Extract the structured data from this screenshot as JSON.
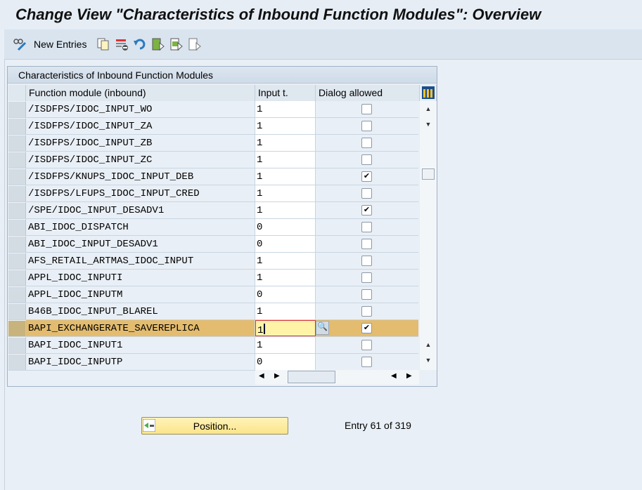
{
  "title": "Change View \"Characteristics of Inbound Function Modules\": Overview",
  "toolbar": {
    "new_entries": "New Entries",
    "icons": [
      "display-change-icon",
      "copy-icon",
      "delete-icon",
      "undo-icon",
      "select-all-icon",
      "select-block-icon",
      "deselect-all-icon"
    ]
  },
  "table": {
    "title": "Characteristics of Inbound Function Modules",
    "columns": [
      "Function module (inbound)",
      "Input t.",
      "Dialog allowed"
    ],
    "rows": [
      {
        "name": "/ISDFPS/IDOC_INPUT_WO",
        "input": "1",
        "dialog": false
      },
      {
        "name": "/ISDFPS/IDOC_INPUT_ZA",
        "input": "1",
        "dialog": false
      },
      {
        "name": "/ISDFPS/IDOC_INPUT_ZB",
        "input": "1",
        "dialog": false
      },
      {
        "name": "/ISDFPS/IDOC_INPUT_ZC",
        "input": "1",
        "dialog": false
      },
      {
        "name": "/ISDFPS/KNUPS_IDOC_INPUT_DEB",
        "input": "1",
        "dialog": true
      },
      {
        "name": "/ISDFPS/LFUPS_IDOC_INPUT_CRED",
        "input": "1",
        "dialog": false
      },
      {
        "name": "/SPE/IDOC_INPUT_DESADV1",
        "input": "1",
        "dialog": true
      },
      {
        "name": "ABI_IDOC_DISPATCH",
        "input": "0",
        "dialog": false
      },
      {
        "name": "ABI_IDOC_INPUT_DESADV1",
        "input": "0",
        "dialog": false
      },
      {
        "name": "AFS_RETAIL_ARTMAS_IDOC_INPUT",
        "input": "1",
        "dialog": false
      },
      {
        "name": "APPL_IDOC_INPUTI",
        "input": "1",
        "dialog": false
      },
      {
        "name": "APPL_IDOC_INPUTM",
        "input": "0",
        "dialog": false
      },
      {
        "name": "B46B_IDOC_INPUT_BLAREL",
        "input": "1",
        "dialog": false
      },
      {
        "name": "BAPI_EXCHANGERATE_SAVEREPLICA",
        "input": "1",
        "dialog": true,
        "selected": true
      },
      {
        "name": "BAPI_IDOC_INPUT1",
        "input": "1",
        "dialog": false
      },
      {
        "name": "BAPI_IDOC_INPUTP",
        "input": "0",
        "dialog": false
      }
    ]
  },
  "footer": {
    "position_button": "Position...",
    "entry_info": "Entry 61 of 319"
  }
}
